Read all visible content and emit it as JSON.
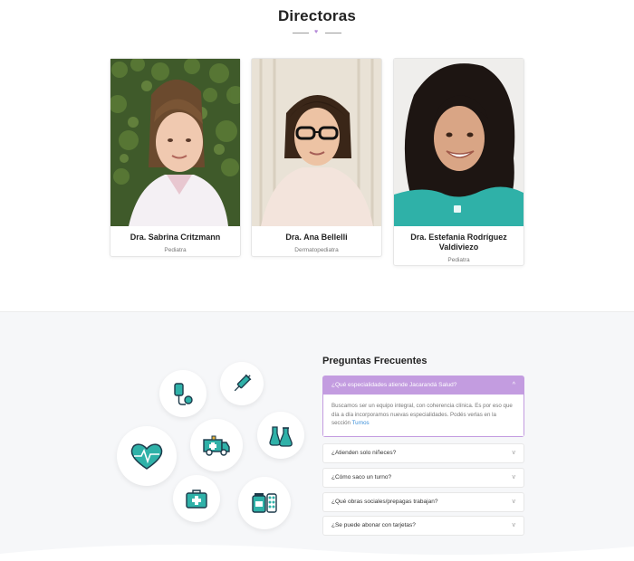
{
  "directoras": {
    "title": "Directoras",
    "cards": [
      {
        "name": "Dra. Sabrina Critzmann",
        "role": "Pediatra"
      },
      {
        "name": "Dra. Ana Bellelli",
        "role": "Dermatopediatra"
      },
      {
        "name": "Dra. Estefania Rodríguez Valdiviezo",
        "role": "Pediatra"
      }
    ]
  },
  "faq": {
    "title": "Preguntas Frecuentes",
    "items": [
      {
        "question": "¿Qué especialidades atiende Jacarandá Salud?",
        "open": true,
        "answer": "Buscamos ser un equipo integral, con coherencia clínica. Es por eso que día a día incorporamos nuevas especialidades. Podés verlas en la sección",
        "answer_link": "Turnos"
      },
      {
        "question": "¿Atienden solo niñeces?",
        "open": false
      },
      {
        "question": "¿Cómo saco un turno?",
        "open": false
      },
      {
        "question": "¿Qué obras sociales/prepagas trabajan?",
        "open": false
      },
      {
        "question": "¿Se puede abonar con tarjetas?",
        "open": false
      }
    ]
  },
  "icons": [
    "iv-drip-icon",
    "syringe-icon",
    "heartbeat-icon",
    "ambulance-icon",
    "flasks-icon",
    "first-aid-kit-icon",
    "pills-icon"
  ],
  "colors": {
    "accent": "#c39ce0",
    "teal": "#2fb1a8",
    "link": "#3b8fd9"
  }
}
